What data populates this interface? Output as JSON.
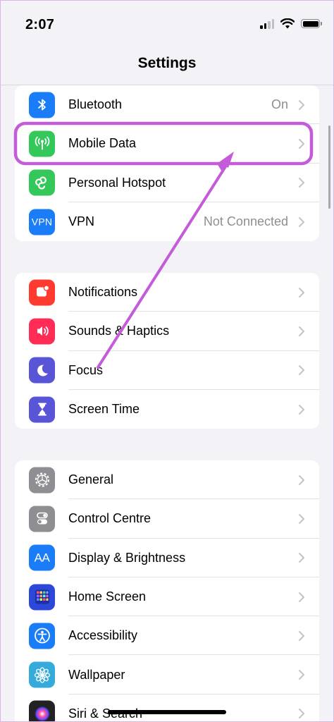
{
  "status_bar": {
    "time": "2:07"
  },
  "nav": {
    "title": "Settings"
  },
  "groups": [
    {
      "items": [
        {
          "label": "Bluetooth",
          "value": "On",
          "icon": "bluetooth-icon",
          "color": "#1a7cf7"
        },
        {
          "label": "Mobile Data",
          "value": "",
          "icon": "antenna-icon",
          "color": "#34c759"
        },
        {
          "label": "Personal Hotspot",
          "value": "",
          "icon": "hotspot-icon",
          "color": "#34c759"
        },
        {
          "label": "VPN",
          "value": "Not Connected",
          "icon": "vpn-icon",
          "icon_text": "VPN",
          "color": "#1a7cf7"
        }
      ]
    },
    {
      "items": [
        {
          "label": "Notifications",
          "value": "",
          "icon": "notifications-bell-icon",
          "color": "#ff3b30"
        },
        {
          "label": "Sounds & Haptics",
          "value": "",
          "icon": "speaker-icon",
          "color": "#ff2d55"
        },
        {
          "label": "Focus",
          "value": "",
          "icon": "moon-icon",
          "color": "#5856d6"
        },
        {
          "label": "Screen Time",
          "value": "",
          "icon": "hourglass-icon",
          "color": "#5856d6"
        }
      ]
    },
    {
      "items": [
        {
          "label": "General",
          "value": "",
          "icon": "gear-icon",
          "color": "#8e8e93"
        },
        {
          "label": "Control Centre",
          "value": "",
          "icon": "toggles-icon",
          "color": "#8e8e93"
        },
        {
          "label": "Display & Brightness",
          "value": "",
          "icon": "display-text-icon",
          "icon_text": "AA",
          "color": "#1a7cf7"
        },
        {
          "label": "Home Screen",
          "value": "",
          "icon": "app-grid-icon",
          "color": "#2d48d8"
        },
        {
          "label": "Accessibility",
          "value": "",
          "icon": "accessibility-icon",
          "color": "#1a7cf7"
        },
        {
          "label": "Wallpaper",
          "value": "",
          "icon": "flower-icon",
          "color": "#37aadc"
        },
        {
          "label": "Siri & Search",
          "value": "",
          "icon": "siri-icon",
          "color": "#222222"
        }
      ]
    }
  ],
  "annotation": {
    "color": "#c45bd9",
    "highlighted_item": "Mobile Data"
  }
}
